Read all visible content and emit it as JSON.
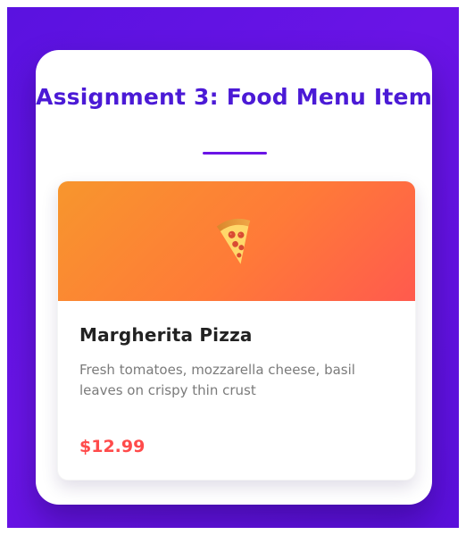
{
  "page": {
    "title": "Assignment 3: Food Menu Item"
  },
  "menu_item": {
    "name": "Margherita Pizza",
    "description_line_1": "Fresh tomatoes, mozzarella cheese, basil",
    "description_line_2": "leaves on crispy thin crust",
    "price": "$12.99",
    "icon": "pizza-slice-icon"
  },
  "colors": {
    "background_purple": "#6a14e6",
    "title_purple": "#4b1ad6",
    "hero_orange": "#f7962d",
    "hero_red": "#ff5a4e",
    "price_red": "#ff4b4b"
  }
}
